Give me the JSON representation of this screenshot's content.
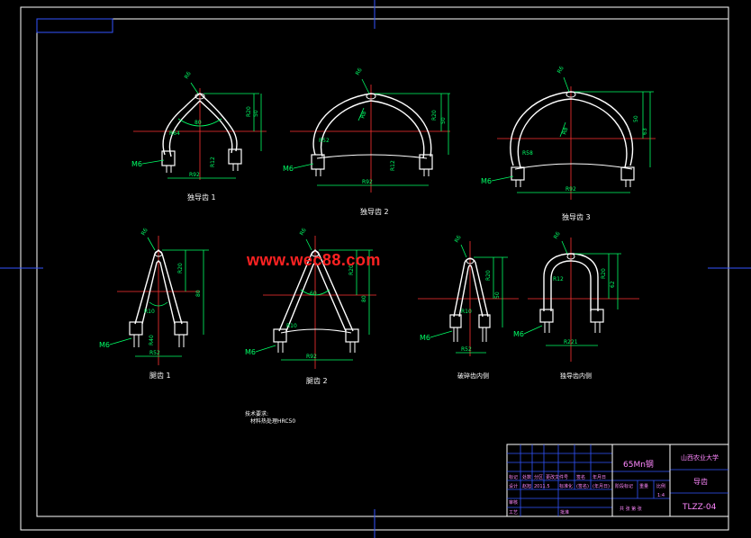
{
  "watermark": "www.wec88.com",
  "thread_label": "M6",
  "figures": [
    {
      "id": "guide-1",
      "caption": "独导齿 1"
    },
    {
      "id": "guide-2",
      "caption": "独导齿 2"
    },
    {
      "id": "guide-3",
      "caption": "独导齿 3"
    },
    {
      "id": "tooth-1",
      "caption": "腿齿 1"
    },
    {
      "id": "tooth-2",
      "caption": "腿齿 2"
    },
    {
      "id": "inner-left",
      "caption": "破碎齿内侧"
    },
    {
      "id": "inner-right",
      "caption": "独导齿内侧"
    }
  ],
  "notes": {
    "title": "技术要求:",
    "line1": "材料热处理HRC50"
  },
  "title_block": {
    "material": "65Mn钢",
    "school": "山西农业大学",
    "part_name": "导齿",
    "drawing_no": "TLZZ-04",
    "ratio": "1:4",
    "row1": [
      "标记",
      "处数",
      "分区",
      "更改文件号",
      "签名",
      "年月日"
    ],
    "row2": [
      "设计",
      "赵旭",
      "2011.5",
      "标准化",
      "(签名)",
      "(年月日)"
    ],
    "stage_labels": [
      "阶段标记",
      "重量",
      "比例"
    ],
    "row3": [
      "审核"
    ],
    "row4": [
      "工艺",
      "",
      "批准"
    ],
    "sheet": "共  张  第  张"
  }
}
